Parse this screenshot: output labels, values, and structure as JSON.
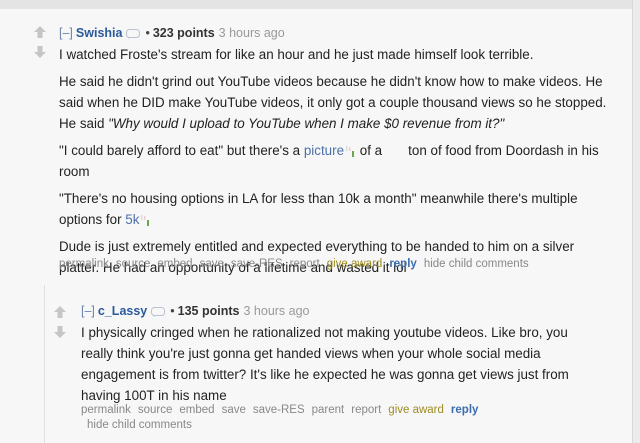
{
  "comments": [
    {
      "author": "Swishia",
      "points": "323 points",
      "time": "3 hours ago",
      "paragraphs": [
        "I watched Froste's stream for like an hour and he just made himself look terrible.",
        "He said he didn't grind out YouTube videos because he didn't know how to make videos. He said when he DID make YouTube videos, it only got a couple thousand views so he stopped. He said",
        "\"Why would I upload to YouTube when I make $0 revenue from it?\"",
        "\"I could barely afford to eat\" but there's a",
        "picture",
        "of a",
        "ton of food from Doordash in his room",
        "\"There's no housing options in LA for less than 10k a month\" meanwhile there's multiple options for",
        "5k",
        "Dude is just extremely entitled and expected everything to be handed to him on a silver platter. He had an opportunity of a lifetime and wasted it lol"
      ],
      "buttons": [
        "permalink",
        "source",
        "embed",
        "save",
        "save-RES",
        "report",
        "give award",
        "reply",
        "hide child comments"
      ]
    },
    {
      "author": "c_Lassy",
      "points": "135 points",
      "time": "3 hours ago",
      "paragraphs": [
        "I physically cringed when he rationalized not making youtube videos. Like bro, you really think you're just gonna get handed views when your whole social media engagement is from twitter? It's like he expected he was gonna get views just from having 100T in his name"
      ],
      "buttons": [
        "permalink",
        "source",
        "embed",
        "save",
        "save-RES",
        "parent",
        "report",
        "give award",
        "reply",
        "hide child comments"
      ]
    }
  ],
  "collapse_label": "[–]",
  "colors": {
    "author": "#2a5a9a",
    "give_award": "#9e8c23",
    "reply": "#3b6db0"
  }
}
